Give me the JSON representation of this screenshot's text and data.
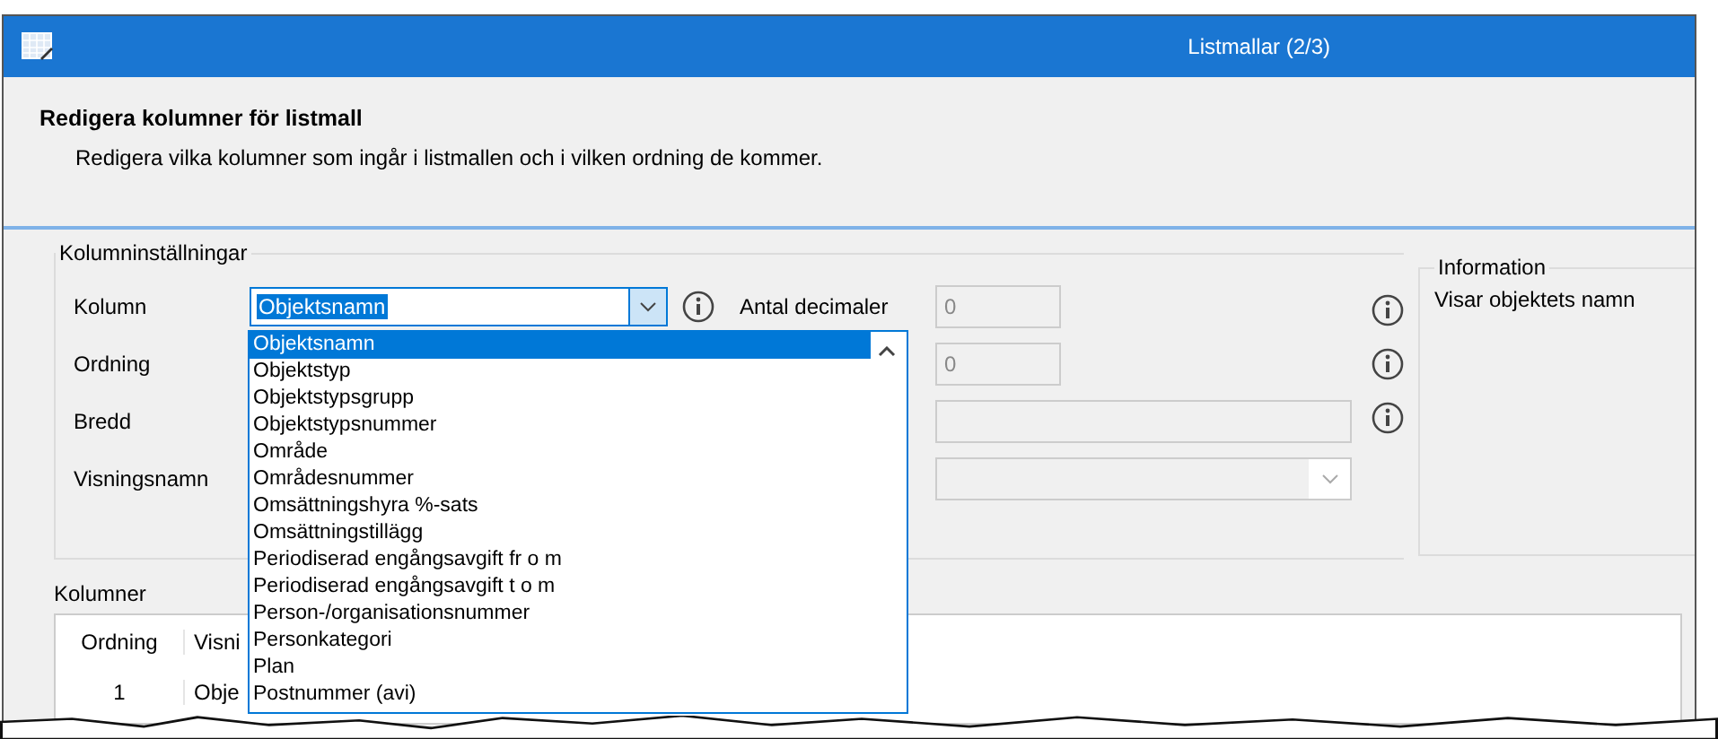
{
  "window": {
    "title": "Listmallar (2/3)"
  },
  "header": {
    "title": "Redigera kolumner för listmall",
    "description": "Redigera vilka kolumner som ingår i listmallen och i vilken ordning de kommer."
  },
  "settings": {
    "title": "Kolumninställningar",
    "kolumn": {
      "label": "Kolumn",
      "value": "Objektsnamn",
      "expanded": true
    },
    "ordning": {
      "label": "Ordning"
    },
    "bredd": {
      "label": "Bredd"
    },
    "visningsnamn": {
      "label": "Visningsnamn"
    },
    "decimals": {
      "label": "Antal decimaler",
      "value": "0",
      "disabled": true
    },
    "order_value": {
      "value": "0",
      "disabled": true
    },
    "width_value": {
      "disabled": true
    },
    "display_name": {
      "disabled": true
    }
  },
  "dropdown_items": [
    {
      "label": "Objektsnamn",
      "selected": true
    },
    {
      "label": "Objektstyp",
      "selected": false
    },
    {
      "label": "Objektstypsgrupp",
      "selected": false
    },
    {
      "label": "Objektstypsnummer",
      "selected": false
    },
    {
      "label": "Område",
      "selected": false
    },
    {
      "label": "Områdesnummer",
      "selected": false
    },
    {
      "label": "Omsättningshyra %-sats",
      "selected": false
    },
    {
      "label": "Omsättningstillägg",
      "selected": false
    },
    {
      "label": "Periodiserad engångsavgift fr o m",
      "selected": false
    },
    {
      "label": "Periodiserad engångsavgift t o m",
      "selected": false
    },
    {
      "label": "Person-/organisationsnummer",
      "selected": false
    },
    {
      "label": "Personkategori",
      "selected": false
    },
    {
      "label": "Plan",
      "selected": false
    },
    {
      "label": "Postnummer (avi)",
      "selected": false
    }
  ],
  "information": {
    "title": "Information",
    "text": "Visar objektets namn"
  },
  "columns_table": {
    "title": "Kolumner",
    "columns": [
      "Ordning",
      "Visni"
    ],
    "rows": [
      [
        "1",
        "Obje"
      ]
    ]
  }
}
